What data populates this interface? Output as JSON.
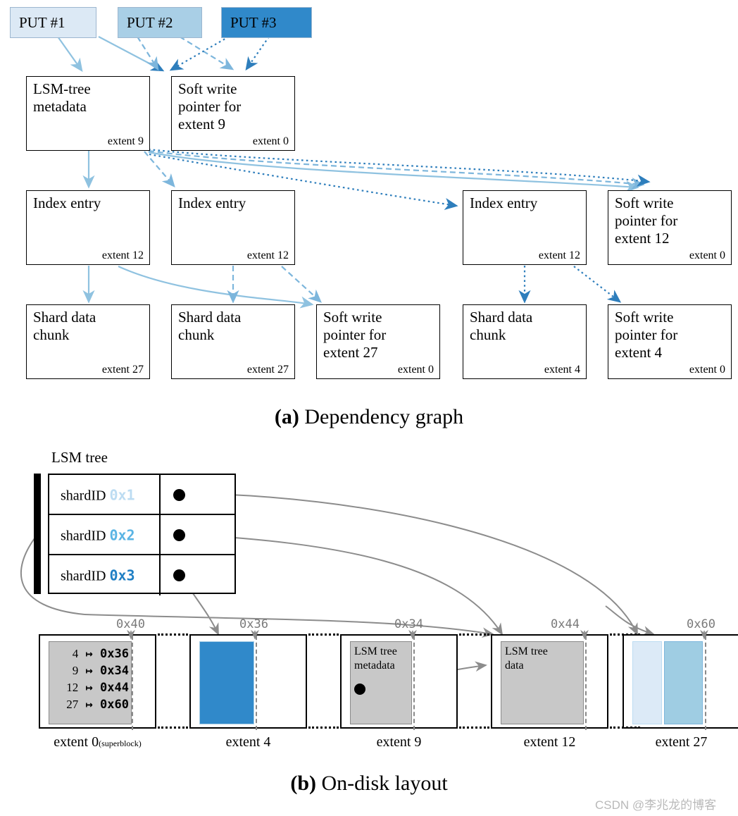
{
  "figure": {
    "panel_a_caption_prefix": "(a)",
    "panel_a_caption": "Dependency graph",
    "panel_b_caption_prefix": "(b)",
    "panel_b_caption": "On-disk layout",
    "watermark": "CSDN @李兆龙的博客"
  },
  "colors": {
    "put1": "#dce9f5",
    "put2": "#a9cfe6",
    "put3": "#3089ca",
    "arrow_light": "#8fc2e0",
    "arrow_mid": "#7db6dc",
    "arrow_dark": "#2e7ebc",
    "gray_line": "#8c8c8c",
    "block_gray": "#c8c8c8",
    "shard1": "#dceaf7",
    "shard2": "#9fcde3",
    "shard3": "#3089ca"
  },
  "dependency_graph": {
    "puts": [
      {
        "label": "PUT #1",
        "color": "#dce9f5"
      },
      {
        "label": "PUT #2",
        "color": "#a9cfe6"
      },
      {
        "label": "PUT #3",
        "color": "#3089ca"
      }
    ],
    "nodes": [
      {
        "id": "lsm-metadata",
        "title": "LSM-tree\nmetadata",
        "extent": "extent 9"
      },
      {
        "id": "swp-extent9",
        "title": "Soft write\npointer for\nextent 9",
        "extent": "extent 0"
      },
      {
        "id": "index-entry-1",
        "title": "Index entry",
        "extent": "extent 12"
      },
      {
        "id": "index-entry-2",
        "title": "Index entry",
        "extent": "extent 12"
      },
      {
        "id": "index-entry-3",
        "title": "Index entry",
        "extent": "extent 12"
      },
      {
        "id": "swp-extent12",
        "title": "Soft write\npointer for\nextent 12",
        "extent": "extent 0"
      },
      {
        "id": "shard-data-chunk-1",
        "title": "Shard data\nchunk",
        "extent": "extent 27"
      },
      {
        "id": "shard-data-chunk-2",
        "title": "Shard data\nchunk",
        "extent": "extent 27"
      },
      {
        "id": "swp-extent27",
        "title": "Soft write\npointer for\nextent 27",
        "extent": "extent 0"
      },
      {
        "id": "shard-data-chunk-3",
        "title": "Shard data\nchunk",
        "extent": "extent 4"
      },
      {
        "id": "swp-extent4",
        "title": "Soft write\npointer for\nextent 4",
        "extent": "extent 0"
      }
    ]
  },
  "on_disk_layout": {
    "lsm_tree_label": "LSM tree",
    "table_rows": [
      {
        "label": "shardID",
        "value": "0x1",
        "color": "#bcdcf2"
      },
      {
        "label": "shardID",
        "value": "0x2",
        "color": "#5ab4e4"
      },
      {
        "label": "shardID",
        "value": "0x3",
        "color": "#1f7fc4"
      }
    ],
    "superblock_map": [
      {
        "key": "4",
        "arrow": "↦",
        "value": "0x36"
      },
      {
        "key": "9",
        "arrow": "↦",
        "value": "0x34"
      },
      {
        "key": "12",
        "arrow": "↦",
        "value": "0x44"
      },
      {
        "key": "27",
        "arrow": "↦",
        "value": "0x60"
      }
    ],
    "extents": [
      {
        "id": "extent-0",
        "label": "extent 0",
        "sublabel": "(superblock)",
        "offset": "0x40"
      },
      {
        "id": "extent-4",
        "label": "extent 4",
        "sublabel": "",
        "offset": "0x36"
      },
      {
        "id": "extent-9",
        "label": "extent 9",
        "sublabel": "",
        "offset": "0x34"
      },
      {
        "id": "extent-12",
        "label": "extent 12",
        "sublabel": "",
        "offset": "0x44"
      },
      {
        "id": "extent-27",
        "label": "extent 27",
        "sublabel": "",
        "offset": "0x60"
      }
    ],
    "block_labels": {
      "lsm_tree_metadata": "LSM tree\nmetadata",
      "lsm_tree_data": "LSM tree\ndata"
    }
  }
}
